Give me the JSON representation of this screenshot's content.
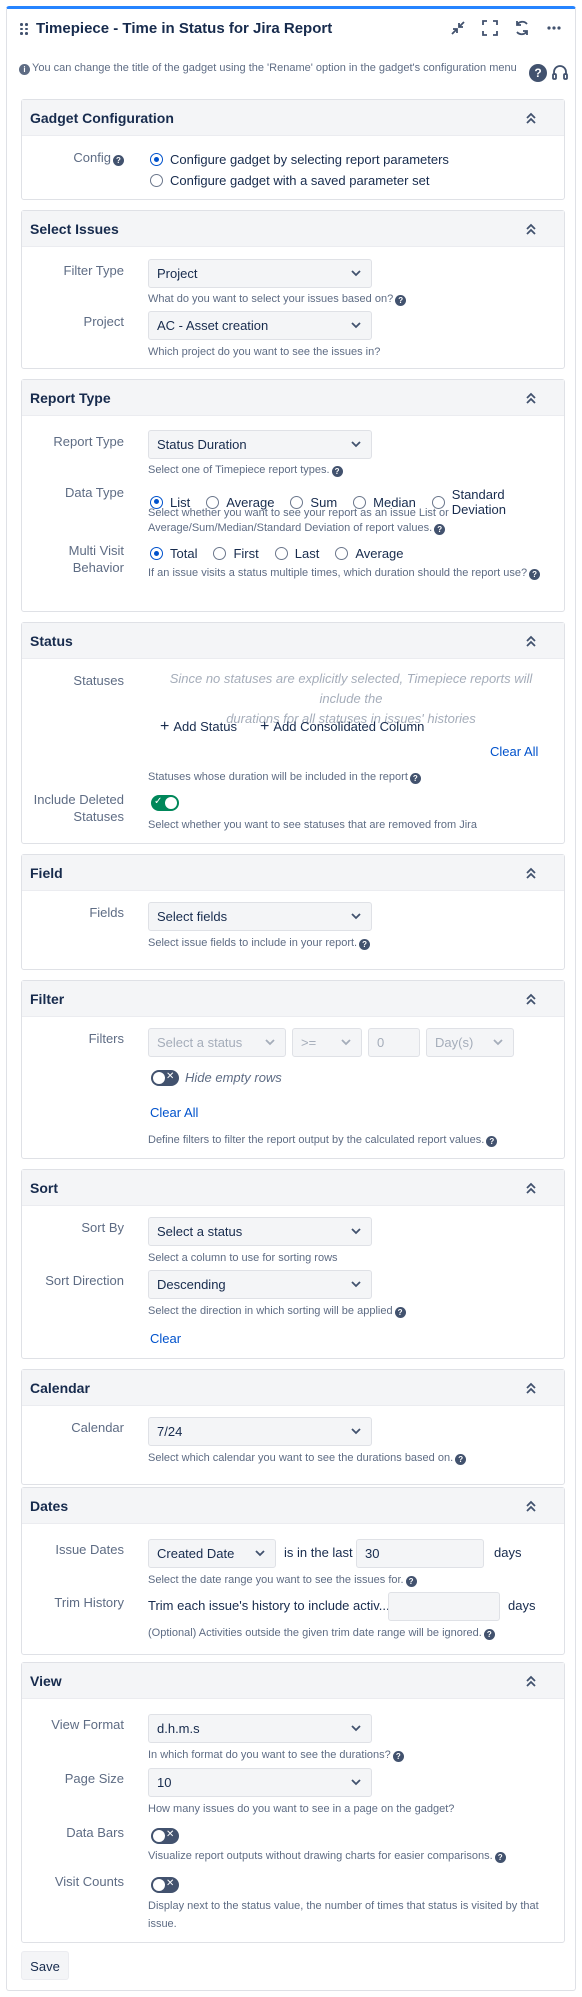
{
  "header": {
    "title": "Timepiece - Time in Status for Jira Report",
    "info": "You can change the title of the gadget using the 'Rename' option in the gadget's configuration menu",
    "help_label": "?"
  },
  "gadget_config": {
    "title": "Gadget Configuration",
    "config_label": "Config",
    "options": [
      "Configure gadget by selecting report parameters",
      "Configure gadget with a saved parameter set"
    ],
    "selected": 0
  },
  "select_issues": {
    "title": "Select Issues",
    "filter_type_label": "Filter Type",
    "filter_type_value": "Project",
    "filter_type_help": "What do you want to select your issues based on?",
    "project_label": "Project",
    "project_value": "AC - Asset creation",
    "project_help": "Which project do you want to see the issues in?"
  },
  "report_type": {
    "title": "Report Type",
    "report_type_label": "Report Type",
    "report_type_value": "Status Duration",
    "report_type_help": "Select one of Timepiece report types.",
    "data_type_label": "Data Type",
    "data_type_options": [
      "List",
      "Average",
      "Sum",
      "Median",
      "Standard Deviation"
    ],
    "data_type_selected": 0,
    "data_type_help_1": "Select whether you want to see your report as an issue List or",
    "data_type_help_2": "Average/Sum/Median/Standard Deviation of report values.",
    "multi_visit_label_1": "Multi Visit",
    "multi_visit_label_2": "Behavior",
    "multi_visit_options": [
      "Total",
      "First",
      "Last",
      "Average"
    ],
    "multi_visit_selected": 0,
    "multi_visit_help": "If an issue visits a status multiple times, which duration should the report use?"
  },
  "status": {
    "title": "Status",
    "statuses_label": "Statuses",
    "placeholder_1": "Since no statuses are explicitly selected, Timepiece reports will include the",
    "placeholder_2": "durations for all statuses in issues' histories",
    "add_status": "Add Status",
    "add_consolidated": "Add Consolidated Column",
    "clear_all": "Clear All",
    "statuses_help": "Statuses whose duration will be included in the report",
    "include_deleted_label_1": "Include Deleted",
    "include_deleted_label_2": "Statuses",
    "include_deleted_on": true,
    "include_deleted_help": "Select whether you want to see statuses that are removed from Jira"
  },
  "field": {
    "title": "Field",
    "fields_label": "Fields",
    "fields_placeholder": "Select fields",
    "fields_help": "Select issue fields to include in your report."
  },
  "filter": {
    "title": "Filter",
    "filters_label": "Filters",
    "status_placeholder": "Select a status",
    "operator": ">=",
    "value": "0",
    "unit": "Day(s)",
    "hide_empty_label": "Hide empty rows",
    "hide_empty_on": false,
    "clear_all": "Clear All",
    "help": "Define filters to filter the report output by the calculated report values."
  },
  "sort": {
    "title": "Sort",
    "sort_by_label": "Sort By",
    "sort_by_placeholder": "Select a status",
    "sort_by_help": "Select a column to use for sorting rows",
    "direction_label": "Sort Direction",
    "direction_value": "Descending",
    "direction_help": "Select the direction in which sorting will be applied",
    "clear": "Clear"
  },
  "calendar": {
    "title": "Calendar",
    "calendar_label": "Calendar",
    "calendar_value": "7/24",
    "calendar_help": "Select which calendar you want to see the durations based on."
  },
  "dates": {
    "title": "Dates",
    "issue_dates_label": "Issue Dates",
    "issue_dates_value": "Created Date",
    "in_last": "is in the last",
    "days_value": "30",
    "days_unit": "days",
    "issue_dates_help": "Select the date range you want to see the issues for.",
    "trim_label": "Trim History",
    "trim_text": "Trim each issue's history to include activ...",
    "trim_value": "",
    "trim_unit": "days",
    "trim_help": "(Optional) Activities outside the given trim date range will be ignored."
  },
  "view": {
    "title": "View",
    "view_format_label": "View Format",
    "view_format_value": "d.h.m.s",
    "view_format_help": "In which format do you want to see the durations?",
    "page_size_label": "Page Size",
    "page_size_value": "10",
    "page_size_help": "How many issues do you want to see in a page on the gadget?",
    "data_bars_label": "Data Bars",
    "data_bars_on": false,
    "data_bars_help": "Visualize report outputs without drawing charts for easier comparisons.",
    "visit_counts_label": "Visit Counts",
    "visit_counts_on": false,
    "visit_counts_help_1": "Display next to the status value, the number of times that status is visited by that",
    "visit_counts_help_2": "issue."
  },
  "footer": {
    "save_label": "Save"
  },
  "colors": {
    "accent": "#0052cc",
    "toggle_on": "#00875a",
    "toggle_off": "#42526e",
    "section_header": "#f4f5f7"
  }
}
